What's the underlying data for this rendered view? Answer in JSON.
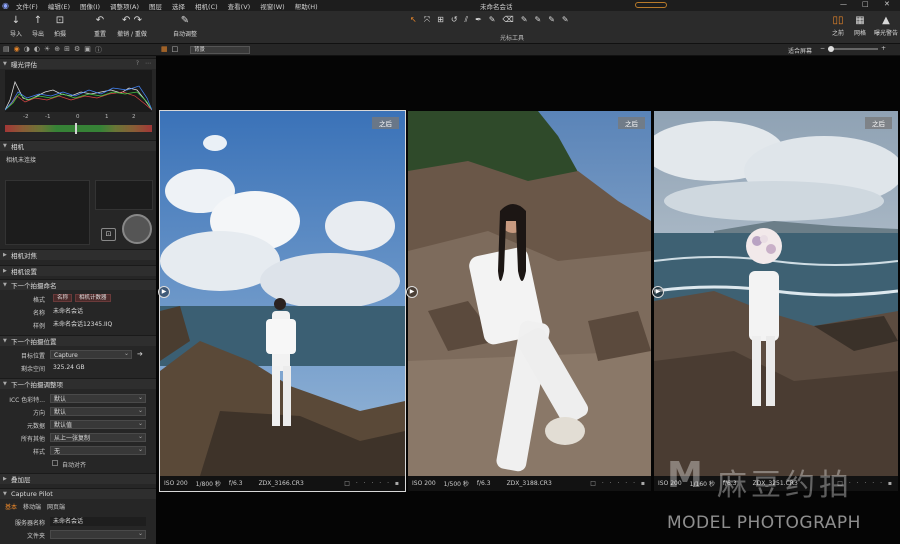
{
  "menubar": {
    "items": [
      "文件(F)",
      "编辑(E)",
      "图像(I)",
      "调整项(A)",
      "图层",
      "选择",
      "相机(C)",
      "查看(V)",
      "视窗(W)",
      "帮助(H)"
    ],
    "title": "未命名会话",
    "controls": [
      "—",
      "□",
      "✕"
    ]
  },
  "toolbar": {
    "buttons": [
      {
        "label": "导入",
        "icon": "↓"
      },
      {
        "label": "导出",
        "icon": "↑"
      },
      {
        "label": "拍摄",
        "icon": "⊡"
      },
      {
        "label": "重置",
        "icon": "↶"
      },
      {
        "label": "撤销 / 重做",
        "icon": "↶ ↷"
      },
      {
        "label": "自动调整",
        "icon": "✎"
      }
    ],
    "cursor_tools_label": "光标工具",
    "cursor_icons": [
      "↖",
      "⤧",
      "⊞",
      "↺",
      "⫽",
      "✒",
      "✎",
      "⌫",
      "✎",
      "✎",
      "✎",
      "✎"
    ],
    "right": [
      {
        "label": "之前",
        "icon": "▯▯"
      },
      {
        "label": "网格",
        "icon": "▦"
      },
      {
        "label": "曝光警告",
        "icon": "▲"
      }
    ]
  },
  "subbar": {
    "variant": "背景",
    "fit_label": "适合屏幕",
    "zoom_minus": "−",
    "zoom_plus": "+"
  },
  "panel": {
    "exposure": {
      "title": "曝光评估",
      "scale": [
        "-2",
        "-1",
        "0",
        "1",
        "2"
      ]
    },
    "camera": {
      "title": "相机",
      "status": "相机未连接"
    },
    "camera_focus": "相机对焦",
    "camera_settings": "相机设置",
    "next_name": {
      "title": "下一个拍摄命名",
      "format_label": "格式",
      "tokens": [
        "名称",
        "相机计数器"
      ],
      "name_label": "名称",
      "name_value": "未命名会话",
      "sample_label": "样例",
      "sample_value": "未命名会话12345.IIQ"
    },
    "next_location": {
      "title": "下一个拍摄位置",
      "target_label": "目标位置",
      "target_value": "Capture",
      "space_label": "剩余空间",
      "space_value": "325.24 GB"
    },
    "next_adjust": {
      "title": "下一个拍摄调整项",
      "rows": [
        {
          "label": "ICC 色彩特...",
          "value": "默认"
        },
        {
          "label": "方向",
          "value": "默认"
        },
        {
          "label": "元数据",
          "value": "默认值"
        },
        {
          "label": "所有其他",
          "value": "从上一张复制"
        },
        {
          "label": "样式",
          "value": "无"
        }
      ],
      "auto_align": "自动对齐"
    },
    "overlay": "叠加层",
    "pilot": {
      "title": "Capture Pilot",
      "tabs": [
        "基本",
        "移动端",
        "网页端"
      ],
      "server_label": "服务器名称",
      "server_value": "未命名会话",
      "folder_label": "文件夹"
    }
  },
  "viewer": {
    "after_label": "之后",
    "images": [
      {
        "iso": "ISO 200",
        "shutter": "1/800 秒",
        "aperture": "f/6.3",
        "file": "ZDX_3166.CR3"
      },
      {
        "iso": "ISO 200",
        "shutter": "1/500 秒",
        "aperture": "f/6.3",
        "file": "ZDX_3188.CR3"
      },
      {
        "iso": "ISO 200",
        "shutter": "1/160 秒",
        "aperture": "f/6.3",
        "file": "ZDX_3251.CR3"
      }
    ]
  },
  "watermark": {
    "logo": "M",
    "cn": "麻豆约拍",
    "en": "MODEL PHOTOGRAPH"
  }
}
